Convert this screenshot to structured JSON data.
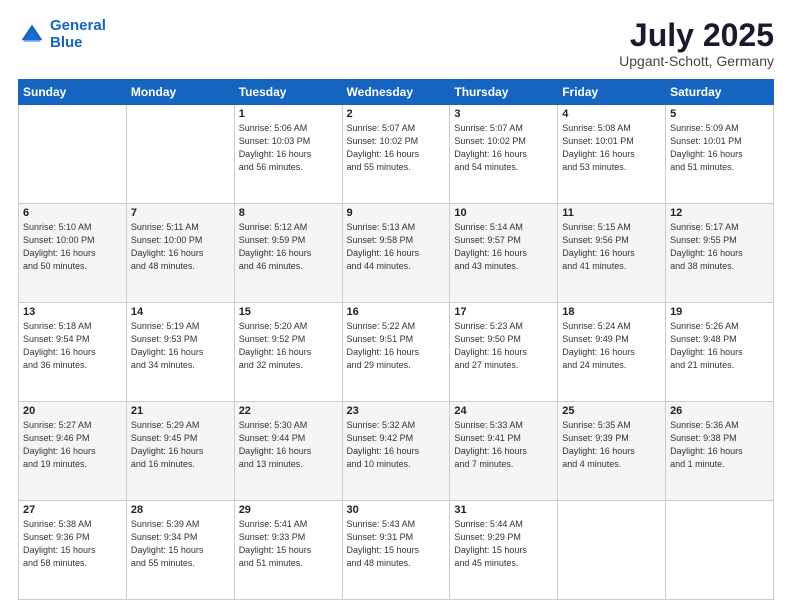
{
  "logo": {
    "line1": "General",
    "line2": "Blue"
  },
  "title": "July 2025",
  "subtitle": "Upgant-Schott, Germany",
  "header_days": [
    "Sunday",
    "Monday",
    "Tuesday",
    "Wednesday",
    "Thursday",
    "Friday",
    "Saturday"
  ],
  "weeks": [
    [
      {
        "day": "",
        "info": ""
      },
      {
        "day": "",
        "info": ""
      },
      {
        "day": "1",
        "info": "Sunrise: 5:06 AM\nSunset: 10:03 PM\nDaylight: 16 hours\nand 56 minutes."
      },
      {
        "day": "2",
        "info": "Sunrise: 5:07 AM\nSunset: 10:02 PM\nDaylight: 16 hours\nand 55 minutes."
      },
      {
        "day": "3",
        "info": "Sunrise: 5:07 AM\nSunset: 10:02 PM\nDaylight: 16 hours\nand 54 minutes."
      },
      {
        "day": "4",
        "info": "Sunrise: 5:08 AM\nSunset: 10:01 PM\nDaylight: 16 hours\nand 53 minutes."
      },
      {
        "day": "5",
        "info": "Sunrise: 5:09 AM\nSunset: 10:01 PM\nDaylight: 16 hours\nand 51 minutes."
      }
    ],
    [
      {
        "day": "6",
        "info": "Sunrise: 5:10 AM\nSunset: 10:00 PM\nDaylight: 16 hours\nand 50 minutes."
      },
      {
        "day": "7",
        "info": "Sunrise: 5:11 AM\nSunset: 10:00 PM\nDaylight: 16 hours\nand 48 minutes."
      },
      {
        "day": "8",
        "info": "Sunrise: 5:12 AM\nSunset: 9:59 PM\nDaylight: 16 hours\nand 46 minutes."
      },
      {
        "day": "9",
        "info": "Sunrise: 5:13 AM\nSunset: 9:58 PM\nDaylight: 16 hours\nand 44 minutes."
      },
      {
        "day": "10",
        "info": "Sunrise: 5:14 AM\nSunset: 9:57 PM\nDaylight: 16 hours\nand 43 minutes."
      },
      {
        "day": "11",
        "info": "Sunrise: 5:15 AM\nSunset: 9:56 PM\nDaylight: 16 hours\nand 41 minutes."
      },
      {
        "day": "12",
        "info": "Sunrise: 5:17 AM\nSunset: 9:55 PM\nDaylight: 16 hours\nand 38 minutes."
      }
    ],
    [
      {
        "day": "13",
        "info": "Sunrise: 5:18 AM\nSunset: 9:54 PM\nDaylight: 16 hours\nand 36 minutes."
      },
      {
        "day": "14",
        "info": "Sunrise: 5:19 AM\nSunset: 9:53 PM\nDaylight: 16 hours\nand 34 minutes."
      },
      {
        "day": "15",
        "info": "Sunrise: 5:20 AM\nSunset: 9:52 PM\nDaylight: 16 hours\nand 32 minutes."
      },
      {
        "day": "16",
        "info": "Sunrise: 5:22 AM\nSunset: 9:51 PM\nDaylight: 16 hours\nand 29 minutes."
      },
      {
        "day": "17",
        "info": "Sunrise: 5:23 AM\nSunset: 9:50 PM\nDaylight: 16 hours\nand 27 minutes."
      },
      {
        "day": "18",
        "info": "Sunrise: 5:24 AM\nSunset: 9:49 PM\nDaylight: 16 hours\nand 24 minutes."
      },
      {
        "day": "19",
        "info": "Sunrise: 5:26 AM\nSunset: 9:48 PM\nDaylight: 16 hours\nand 21 minutes."
      }
    ],
    [
      {
        "day": "20",
        "info": "Sunrise: 5:27 AM\nSunset: 9:46 PM\nDaylight: 16 hours\nand 19 minutes."
      },
      {
        "day": "21",
        "info": "Sunrise: 5:29 AM\nSunset: 9:45 PM\nDaylight: 16 hours\nand 16 minutes."
      },
      {
        "day": "22",
        "info": "Sunrise: 5:30 AM\nSunset: 9:44 PM\nDaylight: 16 hours\nand 13 minutes."
      },
      {
        "day": "23",
        "info": "Sunrise: 5:32 AM\nSunset: 9:42 PM\nDaylight: 16 hours\nand 10 minutes."
      },
      {
        "day": "24",
        "info": "Sunrise: 5:33 AM\nSunset: 9:41 PM\nDaylight: 16 hours\nand 7 minutes."
      },
      {
        "day": "25",
        "info": "Sunrise: 5:35 AM\nSunset: 9:39 PM\nDaylight: 16 hours\nand 4 minutes."
      },
      {
        "day": "26",
        "info": "Sunrise: 5:36 AM\nSunset: 9:38 PM\nDaylight: 16 hours\nand 1 minute."
      }
    ],
    [
      {
        "day": "27",
        "info": "Sunrise: 5:38 AM\nSunset: 9:36 PM\nDaylight: 15 hours\nand 58 minutes."
      },
      {
        "day": "28",
        "info": "Sunrise: 5:39 AM\nSunset: 9:34 PM\nDaylight: 15 hours\nand 55 minutes."
      },
      {
        "day": "29",
        "info": "Sunrise: 5:41 AM\nSunset: 9:33 PM\nDaylight: 15 hours\nand 51 minutes."
      },
      {
        "day": "30",
        "info": "Sunrise: 5:43 AM\nSunset: 9:31 PM\nDaylight: 15 hours\nand 48 minutes."
      },
      {
        "day": "31",
        "info": "Sunrise: 5:44 AM\nSunset: 9:29 PM\nDaylight: 15 hours\nand 45 minutes."
      },
      {
        "day": "",
        "info": ""
      },
      {
        "day": "",
        "info": ""
      }
    ]
  ]
}
